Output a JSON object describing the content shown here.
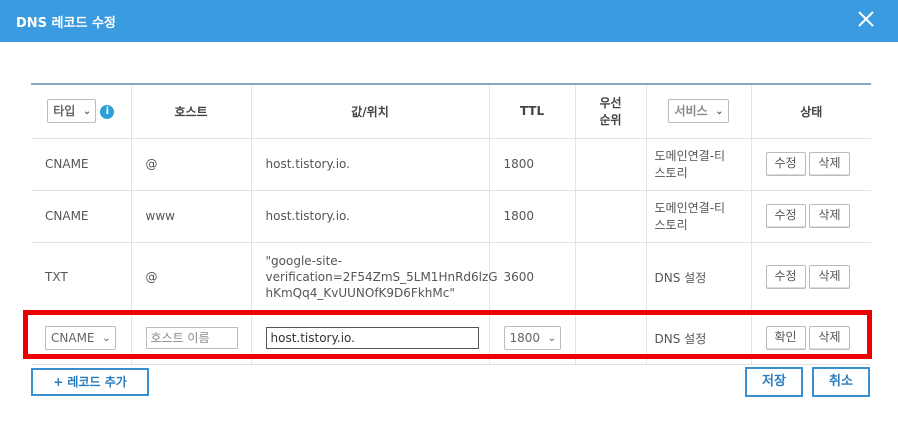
{
  "dialog": {
    "title": "DNS 레코드 수정",
    "accent_color": "#3b9be0",
    "close_icon": "close-icon"
  },
  "table": {
    "headers": {
      "type_select": "타입",
      "info_glyph": "i",
      "host": "호스트",
      "value": "값/위치",
      "ttl": "TTL",
      "priority_line1": "우선",
      "priority_line2": "순위",
      "service_select": "서비스",
      "status": "상태"
    },
    "rows": [
      {
        "type": "CNAME",
        "host": "@",
        "value": "host.tistory.io.",
        "ttl": "1800",
        "priority": "",
        "service_line1": "도메인연결-티",
        "service_line2": "스토리",
        "edit": "수정",
        "delete": "삭제"
      },
      {
        "type": "CNAME",
        "host": "www",
        "value": "host.tistory.io.",
        "ttl": "1800",
        "priority": "",
        "service_line1": "도메인연결-티",
        "service_line2": "스토리",
        "edit": "수정",
        "delete": "삭제"
      },
      {
        "type": "TXT",
        "host": "@",
        "value_line1": "\"google-site-",
        "value_line2": "verification=2F54ZmS_5LM1HnRd6lzG",
        "value_line3": "hKmQq4_KvUUNOfK9D6FkhMc\"",
        "ttl": "3600",
        "priority": "",
        "service": "DNS 설정",
        "edit": "수정",
        "delete": "삭제"
      }
    ],
    "edit_row": {
      "type_value": "CNAME",
      "host_placeholder": "호스트 이름",
      "value_input": "host.tistory.io.",
      "ttl_value": "1800",
      "service": "DNS 설정",
      "confirm": "확인",
      "delete": "삭제"
    }
  },
  "footer": {
    "add_record": "+ 레코드 추가",
    "save": "저장",
    "cancel": "취소"
  },
  "colors": {
    "highlight": "#ee0000",
    "button_border": "#3a8fd0"
  }
}
